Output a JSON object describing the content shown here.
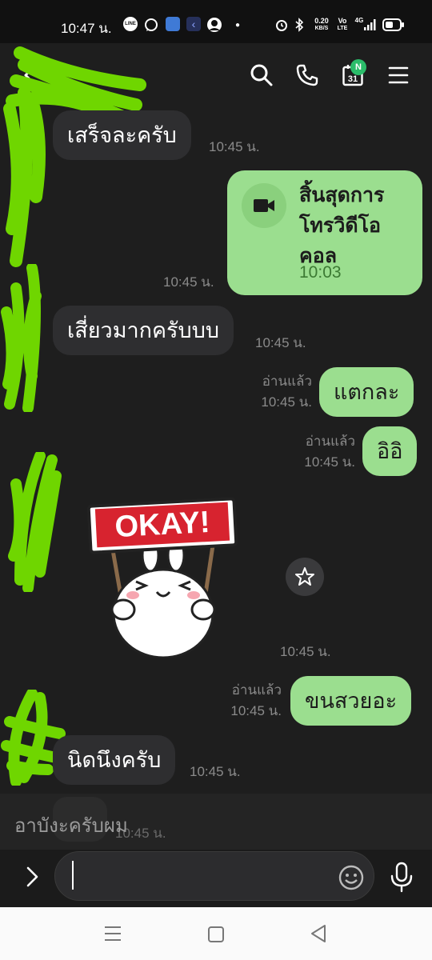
{
  "status_bar": {
    "time": "10:47 น.",
    "speed_value": "0.20",
    "speed_unit": "KB/S",
    "volte_top": "Vo",
    "volte_bottom": "LTE",
    "network": "4G"
  },
  "header": {
    "contact_name": "",
    "calendar_day": "31",
    "calendar_badge": "N"
  },
  "messages": [
    {
      "direction": "in",
      "text": "เสร็จละครับ",
      "time": "10:45 น."
    },
    {
      "direction": "out",
      "type": "video_call",
      "title": "สิ้นสุดการ\nโทรวิดีโอ\nคอล",
      "duration": "10:03",
      "time": "10:45 น."
    },
    {
      "direction": "in",
      "text": "เสี่ยวมากครับบบ",
      "time": "10:45 น."
    },
    {
      "direction": "out",
      "text": "แตกละ",
      "read": "อ่านแล้ว",
      "time": "10:45 น."
    },
    {
      "direction": "out",
      "text": "อิอิ",
      "read": "อ่านแล้ว",
      "time": "10:45 น."
    },
    {
      "direction": "in",
      "type": "sticker",
      "sticker_text": "OKAY!",
      "time": "10:45 น."
    },
    {
      "direction": "out",
      "text": "ขนสวยอะ",
      "read": "อ่านแล้ว",
      "time": "10:45 น."
    },
    {
      "direction": "in",
      "text": "นิดนึงครับ",
      "time": "10:45 น."
    }
  ],
  "reply_preview": {
    "text": "อาบังะครับผม",
    "ghost_time": "10:45 น."
  },
  "input": {
    "value": "",
    "placeholder": ""
  },
  "colors": {
    "background": "#1e1e1e",
    "incoming_bubble": "#2e2e30",
    "outgoing_bubble": "#9bde8f",
    "badge": "#2bbd6a",
    "redaction": "#6fd600"
  },
  "icons": [
    "back-icon",
    "search-icon",
    "phone-icon",
    "calendar-icon",
    "menu-icon",
    "video-camera-icon",
    "star-icon",
    "expand-icon",
    "emoji-icon",
    "microphone-icon",
    "recents-icon",
    "home-icon",
    "back-nav-icon"
  ]
}
